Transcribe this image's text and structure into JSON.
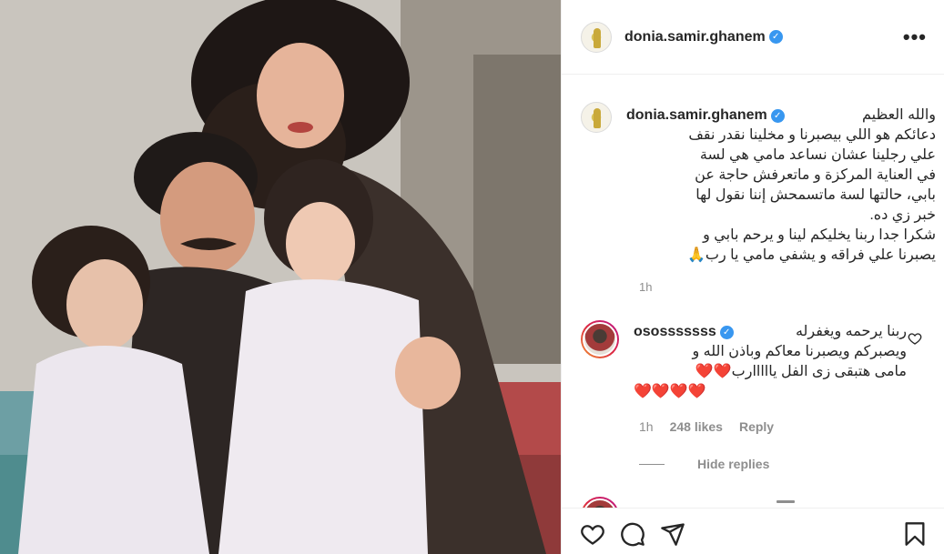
{
  "post": {
    "username": "donia.samir.ghanem",
    "more_icon": "•••",
    "photo": {
      "alt_icon": "family-photo"
    }
  },
  "caption": {
    "username": "donia.samir.ghanem",
    "lines": [
      "والله العظيم",
      "دعائكم هو اللي بيصبرنا و مخلينا نقدر نقف",
      "علي رجلينا عشان نساعد مامي هي لسة",
      "في العناية المركزة و ماتعرفش حاجة عن",
      "بابي، حالتها لسة ماتسمحش إننا نقول لها",
      "خبر زي ده.",
      "شكرا جدا ربنا يخليكم لينا و يرحم بابي و",
      "يصبرنا علي فراقه و يشفي مامي يا رب🙏"
    ],
    "time": "1h"
  },
  "comment": {
    "username": "ososssssss",
    "lines": [
      "ربنا يرحمه ويغفرله",
      "ويصبركم ويصبرنا معاكم وباذن الله و",
      "مامى هتبقى زى الفل يااااارب❤️❤️",
      "❤️❤️❤️❤️"
    ],
    "time": "1h",
    "likes": "248 likes",
    "reply": "Reply",
    "hide_replies": "Hide replies"
  },
  "colors": {
    "verified": "#3897f0",
    "text": "#262626",
    "muted": "#8e8e8e",
    "heart": "#e0245e"
  },
  "icons": {
    "like": "heart-outline-icon",
    "comment": "comment-bubble-icon",
    "share": "paper-plane-icon",
    "save": "bookmark-icon"
  }
}
